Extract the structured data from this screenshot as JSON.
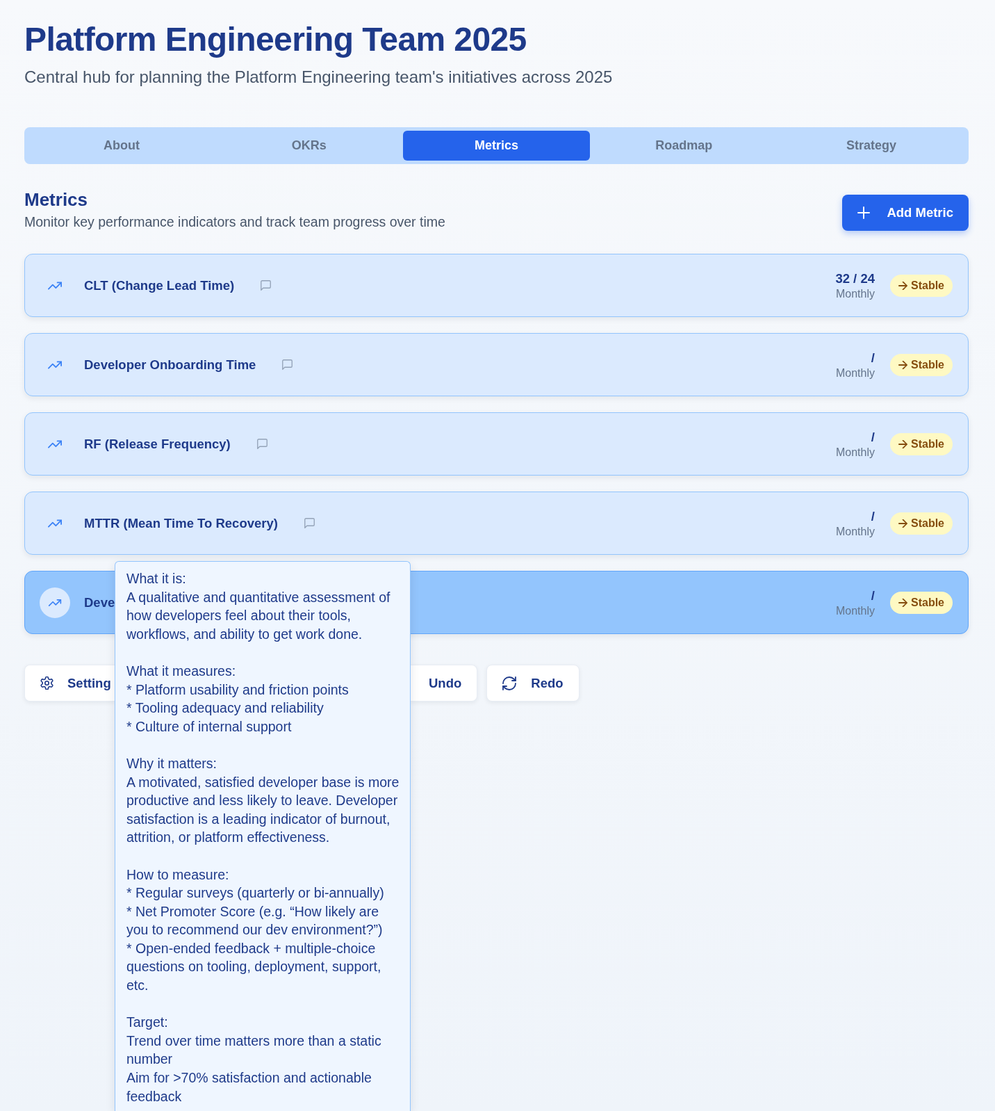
{
  "header": {
    "title": "Platform Engineering Team 2025",
    "subtitle": "Central hub for planning the Platform Engineering team's initiatives across 2025"
  },
  "tabs": [
    {
      "label": "About",
      "selected": false
    },
    {
      "label": "OKRs",
      "selected": false
    },
    {
      "label": "Metrics",
      "selected": true
    },
    {
      "label": "Roadmap",
      "selected": false
    },
    {
      "label": "Strategy",
      "selected": false
    }
  ],
  "section": {
    "title": "Metrics",
    "description": "Monitor key performance indicators and track team progress over time",
    "add_button": "Add Metric"
  },
  "metrics": [
    {
      "name": "CLT (Change Lead Time)",
      "value": "32 / 24",
      "frequency": "Monthly",
      "status": "Stable",
      "highlighted": false
    },
    {
      "name": "Developer Onboarding Time",
      "value": "/",
      "frequency": "Monthly",
      "status": "Stable",
      "highlighted": false
    },
    {
      "name": "RF (Release Frequency)",
      "value": "/",
      "frequency": "Monthly",
      "status": "Stable",
      "highlighted": false
    },
    {
      "name": "MTTR (Mean Time To Recovery)",
      "value": "/",
      "frequency": "Monthly",
      "status": "Stable",
      "highlighted": false
    },
    {
      "name": "Deve",
      "value": "/",
      "frequency": "Monthly",
      "status": "Stable",
      "highlighted": true
    }
  ],
  "toolbar": [
    {
      "kind": "settings",
      "label": "Setting",
      "left_hidden": false,
      "right_hidden": true
    },
    {
      "kind": "undo",
      "label": "Undo",
      "left_hidden": true,
      "right_hidden": false
    },
    {
      "kind": "redo",
      "label": "Redo",
      "left_hidden": false,
      "right_hidden": false
    }
  ],
  "tooltip": {
    "sections": [
      {
        "heading": "What it is:",
        "lines": [
          "A qualitative and quantitative assessment of how developers feel about their tools, workflows, and ability to get work done."
        ]
      },
      {
        "heading": "What it measures:",
        "lines": [
          "* Platform usability and friction points",
          "* Tooling adequacy and reliability",
          "* Culture of internal support"
        ]
      },
      {
        "heading": "Why it matters:",
        "lines": [
          "A motivated, satisfied developer base is more productive and less likely to leave. Developer satisfaction is a leading indicator of burnout, attrition, or platform effectiveness."
        ]
      },
      {
        "heading": "How to measure:",
        "lines": [
          "* Regular surveys (quarterly or bi-annually)",
          "* Net Promoter Score (e.g. “How likely are you to recommend our dev environment?”)",
          "* Open-ended feedback + multiple-choice questions on tooling, deployment, support, etc."
        ]
      },
      {
        "heading": "Target:",
        "lines": [
          "Trend over time matters more than a static number",
          "Aim for >70% satisfaction and actionable feedback"
        ]
      }
    ]
  }
}
